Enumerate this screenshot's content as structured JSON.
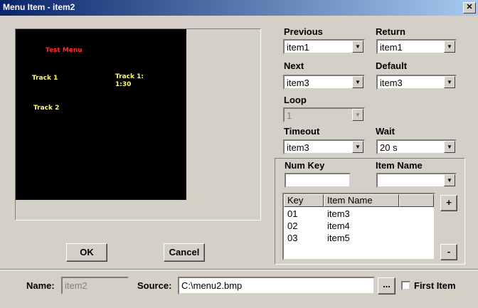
{
  "window": {
    "title": "Menu Item - item2",
    "close_glyph": "✕"
  },
  "preview": {
    "title": "Test Menu",
    "items": [
      "Track 1",
      "Track 1:\n1:30",
      "Track 2"
    ],
    "colors": {
      "title": "#ff2a2a",
      "item": "#ffff66",
      "background": "#000000"
    }
  },
  "fields": {
    "previous": {
      "label": "Previous",
      "value": "item1"
    },
    "return": {
      "label": "Return",
      "value": "item1"
    },
    "next": {
      "label": "Next",
      "value": "item3"
    },
    "default": {
      "label": "Default",
      "value": "item3"
    },
    "loop": {
      "label": "Loop",
      "value": "1"
    },
    "timeout": {
      "label": "Timeout",
      "value": "item3"
    },
    "wait": {
      "label": "Wait",
      "value": "20 s"
    }
  },
  "numkey": {
    "label": "Num Key",
    "value": ""
  },
  "itemname": {
    "label": "Item Name",
    "value": ""
  },
  "list": {
    "headers": [
      "Key",
      "Item Name"
    ],
    "rows": [
      {
        "key": "01",
        "name": "item3"
      },
      {
        "key": "02",
        "name": "item4"
      },
      {
        "key": "03",
        "name": "item5"
      }
    ]
  },
  "buttons": {
    "add": "+",
    "remove": "-",
    "ok": "OK",
    "cancel": "Cancel",
    "browse": "..."
  },
  "footer": {
    "name_label": "Name:",
    "name_value": "item2",
    "source_label": "Source:",
    "source_value": "C:\\menu2.bmp",
    "first_item_label": "First Item"
  },
  "icons": {
    "dropdown_arrow": "▼"
  }
}
